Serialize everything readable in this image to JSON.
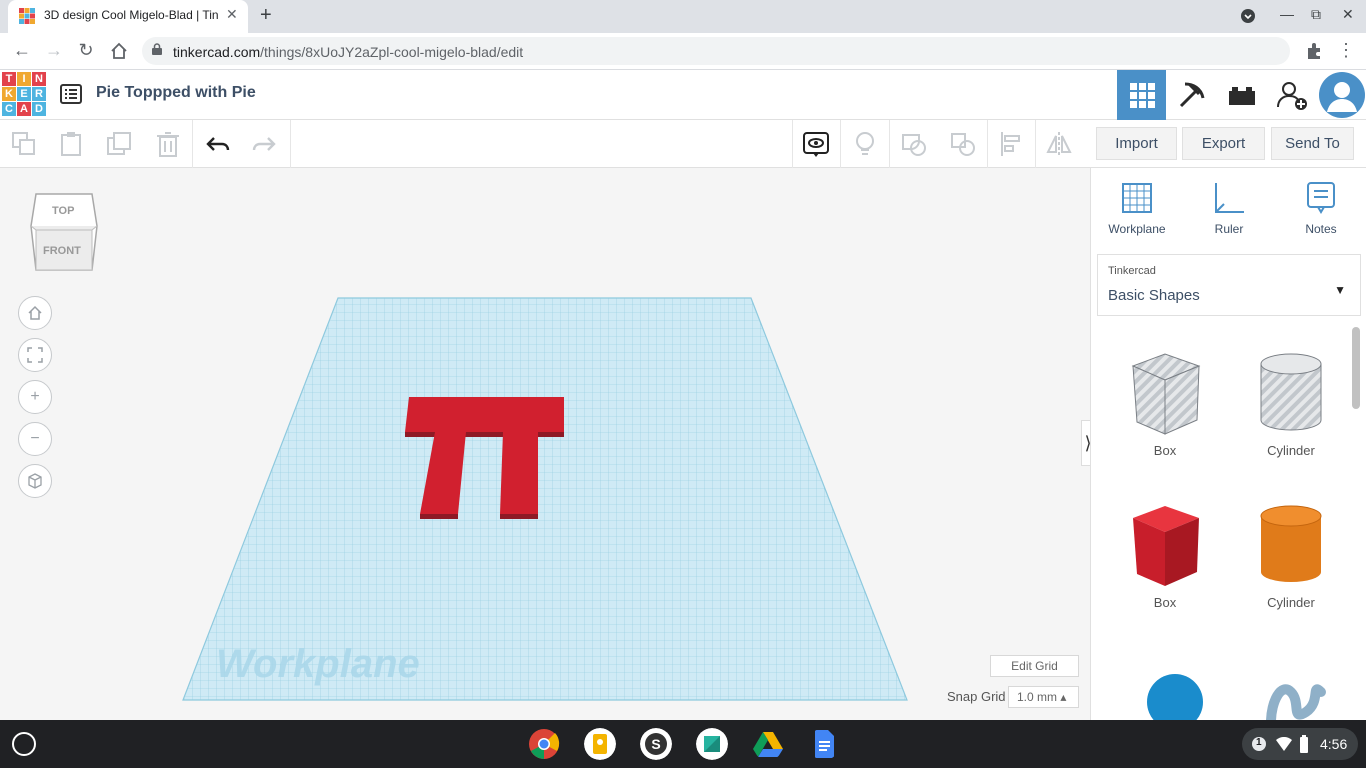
{
  "browser": {
    "tab_title": "3D design Cool Migelo-Blad | Tin",
    "url_host": "tinkercad.com",
    "url_path": "/things/8xUoJY2aZpl-cool-migelo-blad/edit"
  },
  "header": {
    "logo_letters": [
      "T",
      "I",
      "N",
      "K",
      "E",
      "R",
      "C",
      "A",
      "D"
    ],
    "design_title": "Pie Toppped with Pie"
  },
  "toolbar": {
    "import_label": "Import",
    "export_label": "Export",
    "sendto_label": "Send To"
  },
  "viewcube": {
    "top_label": "TOP",
    "front_label": "FRONT"
  },
  "canvas": {
    "workplane_label": "Workplane",
    "edit_grid_label": "Edit Grid",
    "snap_grid_label": "Snap Grid",
    "snap_grid_value": "1.0 mm ▴"
  },
  "panel": {
    "tools": [
      {
        "label": "Workplane",
        "icon": "workplane-icon"
      },
      {
        "label": "Ruler",
        "icon": "ruler-icon"
      },
      {
        "label": "Notes",
        "icon": "notes-icon"
      }
    ],
    "library_source": "Tinkercad",
    "library_name": "Basic Shapes",
    "shapes": [
      {
        "label": "Box",
        "style": "hole"
      },
      {
        "label": "Cylinder",
        "style": "hole"
      },
      {
        "label": "Box",
        "style": "solid",
        "color": "#d1202f"
      },
      {
        "label": "Cylinder",
        "style": "solid",
        "color": "#e07b1a"
      }
    ]
  },
  "shelf": {
    "apps": [
      "chrome-icon",
      "keep-icon",
      "skype-icon",
      "app-icon",
      "drive-icon",
      "docs-icon"
    ],
    "notification_count": "1",
    "time": "4:56"
  },
  "colors": {
    "accent_blue": "#4a90c8",
    "grid_blue": "#a9dcf0",
    "shape_red": "#d1202f"
  }
}
